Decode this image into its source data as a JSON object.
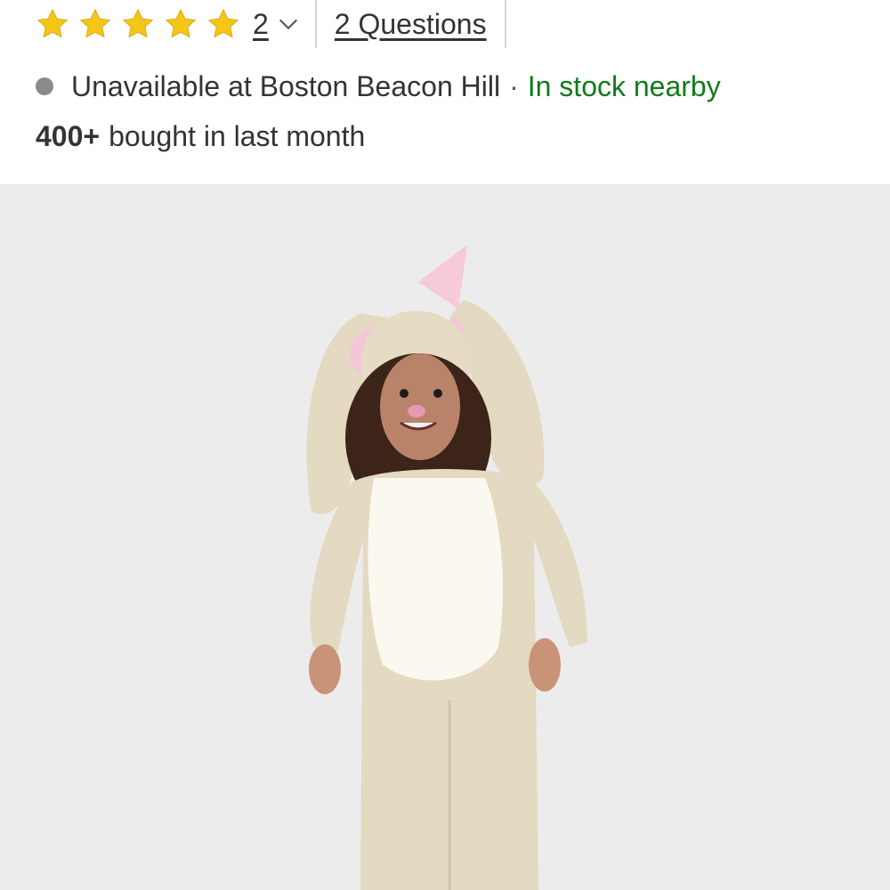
{
  "rating": {
    "stars_filled": 5,
    "stars_total": 5,
    "review_count": "2",
    "questions_label": "2 Questions",
    "star_color": "#F5C518"
  },
  "availability": {
    "store_status": "Unavailable at Boston Beacon Hill",
    "separator": "·",
    "nearby_status": "In stock nearby",
    "nearby_color": "#117A1C",
    "status_dot_color": "#8A8A8A"
  },
  "social_proof": {
    "count": "400+",
    "text": "bought in last month"
  },
  "product_image": {
    "background_color": "#ECECEC",
    "subject": "child in bunny costume"
  },
  "icons": [
    "star-icon",
    "chevron-down-icon"
  ]
}
